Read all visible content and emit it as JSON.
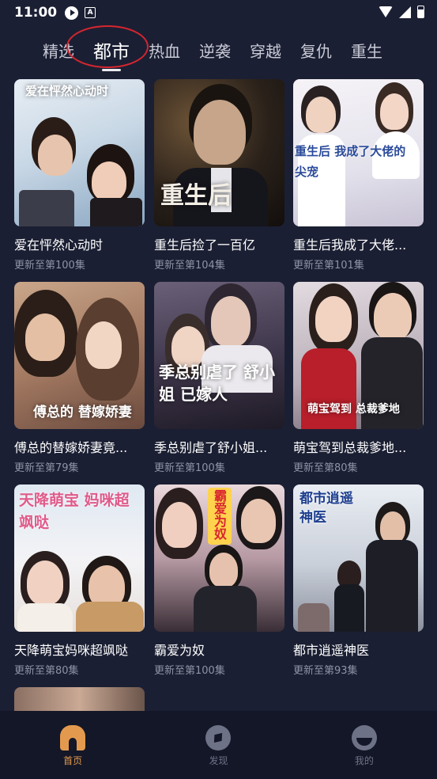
{
  "status_bar": {
    "time": "11:00",
    "icons": [
      "play-notification-icon",
      "a-notification-icon",
      "wifi-icon",
      "signal-icon",
      "battery-icon"
    ]
  },
  "tabs": [
    {
      "label": "精选",
      "active": false
    },
    {
      "label": "都市",
      "active": true
    },
    {
      "label": "热血",
      "active": false
    },
    {
      "label": "逆袭",
      "active": false
    },
    {
      "label": "穿越",
      "active": false
    },
    {
      "label": "复仇",
      "active": false
    },
    {
      "label": "重生",
      "active": false
    }
  ],
  "colors": {
    "background": "#1b1f33",
    "accent": "#e39a4f",
    "annotation_circle": "#d5262f",
    "subtitle": "#8f93a6"
  },
  "dramas": [
    {
      "title": "爱在怦然心动时",
      "subtitle": "更新至第100集",
      "cover_art_text": "爱在怦然心动时"
    },
    {
      "title": "重生后捡了一百亿",
      "subtitle": "更新至第104集",
      "cover_art_text": "重生后"
    },
    {
      "title": "重生后我成了大佬...",
      "subtitle": "更新至第101集",
      "cover_art_text": "重生后 我成了大佬的 尖宠"
    },
    {
      "title": "傅总的替嫁娇妻竟...",
      "subtitle": "更新至第79集",
      "cover_art_text": "傅总的 替嫁娇妻"
    },
    {
      "title": "季总别虐了舒小姐...",
      "subtitle": "更新至第100集",
      "cover_art_text": "季总别虐了 舒小姐 已嫁人"
    },
    {
      "title": "萌宝驾到总裁爹地...",
      "subtitle": "更新至第80集",
      "cover_art_text": "萌宝驾到 总裁爹地"
    },
    {
      "title": "天降萌宝妈咪超飒哒",
      "subtitle": "更新至第80集",
      "cover_art_text": "天降萌宝 妈咪超飒哒"
    },
    {
      "title": "霸爱为奴",
      "subtitle": "更新至第100集",
      "cover_art_text": "霸爱为奴"
    },
    {
      "title": "都市逍遥神医",
      "subtitle": "更新至第93集",
      "cover_art_text": "都市逍遥神医"
    }
  ],
  "bottom_nav": [
    {
      "label": "首页",
      "icon": "home-icon",
      "active": true
    },
    {
      "label": "发现",
      "icon": "compass-icon",
      "active": false
    },
    {
      "label": "我的",
      "icon": "profile-icon",
      "active": false
    }
  ]
}
